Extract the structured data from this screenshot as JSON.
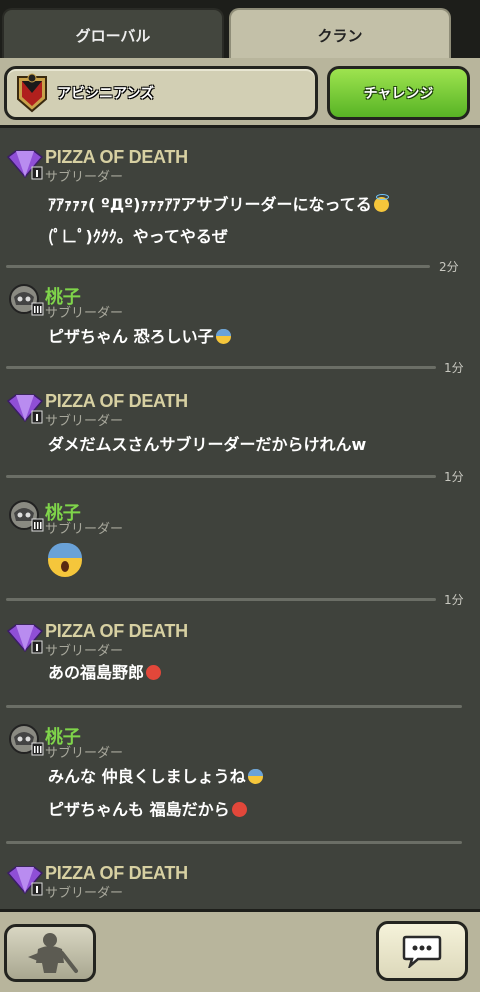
{
  "tabs": {
    "global": "グローバル",
    "clan": "クラン"
  },
  "clan": {
    "name": "アビシニアンズ",
    "challenge_label": "チャレンジ"
  },
  "messages": [
    {
      "user": "PIZZA OF DEATH",
      "role": "サブリーダー",
      "line1": "ｱｱｧｧｧ( ºДº)ｧｧｧｱｱアサブリーダーになってる",
      "line2": "(ﾟ∟ﾟ)ｸｸｸ。やってやるぜ",
      "time": "2分"
    },
    {
      "user": "桃子",
      "role": "サブリーダー",
      "line1": "ピザちゃん 恐ろしい子",
      "time": "1分"
    },
    {
      "user": "PIZZA OF DEATH",
      "role": "サブリーダー",
      "line1": "ダメだムスさんサブリーダーだからけれんw",
      "time": "1分"
    },
    {
      "user": "桃子",
      "role": "サブリーダー",
      "time": "1分"
    },
    {
      "user": "PIZZA OF DEATH",
      "role": "サブリーダー",
      "line1": "あの福島野郎"
    },
    {
      "user": "桃子",
      "role": "サブリーダー",
      "line1": "みんな 仲良くしましょうね",
      "line2": "ピザちゃんも 福島だから"
    },
    {
      "user": "PIZZA OF DEATH",
      "role": "サブリーダー"
    }
  ],
  "icons": {
    "rank_badge": "purple-gem-badge",
    "skull_badge": "skull-helmet-badge",
    "profile": "warrior-silhouette-icon",
    "chat": "speech-bubble-icon"
  },
  "colors": {
    "challenge": "#6fcc32",
    "pizza_name": "#d7d0a2",
    "momo_name": "#7fd54a"
  }
}
